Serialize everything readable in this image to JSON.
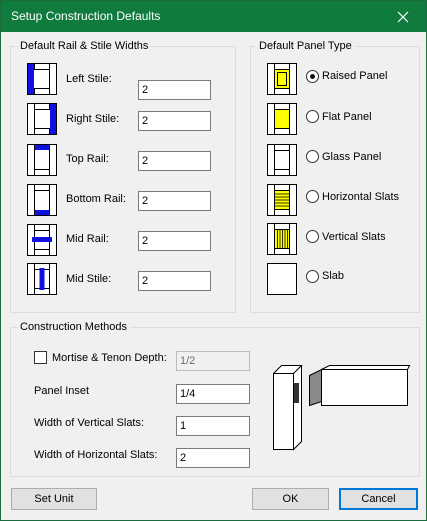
{
  "window": {
    "title": "Setup Construction Defaults",
    "close_icon": "close-x"
  },
  "rail_stile": {
    "label": "Default Rail & Stile Widths",
    "rows": [
      {
        "label": "Left Stile:",
        "value": "2"
      },
      {
        "label": "Right Stile:",
        "value": "2"
      },
      {
        "label": "Top Rail:",
        "value": "2"
      },
      {
        "label": "Bottom Rail:",
        "value": "2"
      },
      {
        "label": "Mid Rail:",
        "value": "2"
      },
      {
        "label": "Mid Stile:",
        "value": "2"
      }
    ]
  },
  "panel_type": {
    "label": "Default Panel Type",
    "options": [
      {
        "label": "Raised Panel",
        "selected": true
      },
      {
        "label": "Flat Panel",
        "selected": false
      },
      {
        "label": "Glass Panel",
        "selected": false
      },
      {
        "label": "Horizontal Slats",
        "selected": false
      },
      {
        "label": "Vertical Slats",
        "selected": false
      },
      {
        "label": "Slab",
        "selected": false
      }
    ]
  },
  "construction": {
    "label": "Construction Methods",
    "mortise": {
      "label": "Mortise & Tenon Depth:",
      "checked": false,
      "value": "1/2"
    },
    "panel_inset": {
      "label": "Panel Inset",
      "value": "1/4"
    },
    "vertical_slats": {
      "label": "Width of Vertical Slats:",
      "value": "1"
    },
    "horizontal_slats": {
      "label": "Width of Horizontal Slats:",
      "value": "2"
    }
  },
  "buttons": {
    "set_unit": "Set Unit",
    "ok": "OK",
    "cancel": "Cancel"
  },
  "colors": {
    "title_bar": "#0f7b3d",
    "highlight_blue": "#1010e0",
    "panel_yellow": "#ffff00"
  }
}
